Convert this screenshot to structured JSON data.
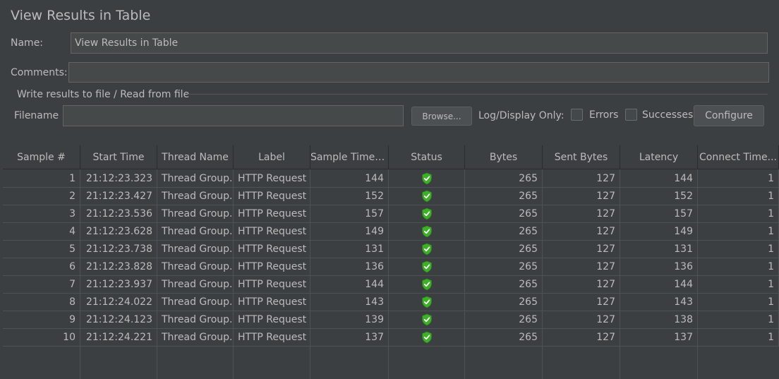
{
  "panel": {
    "title": "View Results in Table",
    "name_label": "Name:",
    "name_value": "View Results in Table",
    "comments_label": "Comments:",
    "comments_value": ""
  },
  "file_group": {
    "title": "Write results to file / Read from file",
    "filename_label": "Filename",
    "filename_value": "",
    "browse_label": "Browse...",
    "log_display_label": "Log/Display Only:",
    "errors_label": "Errors",
    "errors_checked": false,
    "successes_label": "Successes",
    "successes_checked": false,
    "configure_label": "Configure"
  },
  "table": {
    "columns": [
      "Sample #",
      "Start Time",
      "Thread Name",
      "Label",
      "Sample Time(...",
      "Status",
      "Bytes",
      "Sent Bytes",
      "Latency",
      "Connect Time..."
    ],
    "rows": [
      {
        "sample": "1",
        "start": "21:12:23.323",
        "thread": "Thread Group...",
        "label": "HTTP Request",
        "time": "144",
        "status": "success-shield-icon",
        "bytes": "265",
        "sent": "127",
        "latency": "144",
        "connect": "1"
      },
      {
        "sample": "2",
        "start": "21:12:23.427",
        "thread": "Thread Group...",
        "label": "HTTP Request",
        "time": "152",
        "status": "success-shield-icon",
        "bytes": "265",
        "sent": "127",
        "latency": "152",
        "connect": "1"
      },
      {
        "sample": "3",
        "start": "21:12:23.536",
        "thread": "Thread Group...",
        "label": "HTTP Request",
        "time": "157",
        "status": "success-shield-icon",
        "bytes": "265",
        "sent": "127",
        "latency": "157",
        "connect": "1"
      },
      {
        "sample": "4",
        "start": "21:12:23.628",
        "thread": "Thread Group...",
        "label": "HTTP Request",
        "time": "149",
        "status": "success-shield-icon",
        "bytes": "265",
        "sent": "127",
        "latency": "149",
        "connect": "1"
      },
      {
        "sample": "5",
        "start": "21:12:23.738",
        "thread": "Thread Group...",
        "label": "HTTP Request",
        "time": "131",
        "status": "success-shield-icon",
        "bytes": "265",
        "sent": "127",
        "latency": "131",
        "connect": "1"
      },
      {
        "sample": "6",
        "start": "21:12:23.828",
        "thread": "Thread Group...",
        "label": "HTTP Request",
        "time": "136",
        "status": "success-shield-icon",
        "bytes": "265",
        "sent": "127",
        "latency": "136",
        "connect": "1"
      },
      {
        "sample": "7",
        "start": "21:12:23.937",
        "thread": "Thread Group...",
        "label": "HTTP Request",
        "time": "144",
        "status": "success-shield-icon",
        "bytes": "265",
        "sent": "127",
        "latency": "144",
        "connect": "1"
      },
      {
        "sample": "8",
        "start": "21:12:24.022",
        "thread": "Thread Group...",
        "label": "HTTP Request",
        "time": "143",
        "status": "success-shield-icon",
        "bytes": "265",
        "sent": "127",
        "latency": "143",
        "connect": "1"
      },
      {
        "sample": "9",
        "start": "21:12:24.123",
        "thread": "Thread Group...",
        "label": "HTTP Request",
        "time": "139",
        "status": "success-shield-icon",
        "bytes": "265",
        "sent": "127",
        "latency": "138",
        "connect": "1"
      },
      {
        "sample": "10",
        "start": "21:12:24.221",
        "thread": "Thread Group...",
        "label": "HTTP Request",
        "time": "137",
        "status": "success-shield-icon",
        "bytes": "265",
        "sent": "127",
        "latency": "137",
        "connect": "1"
      }
    ]
  },
  "colors": {
    "background": "#3c3f41",
    "text": "#bbbbbb",
    "success_green": "#3fae29"
  }
}
